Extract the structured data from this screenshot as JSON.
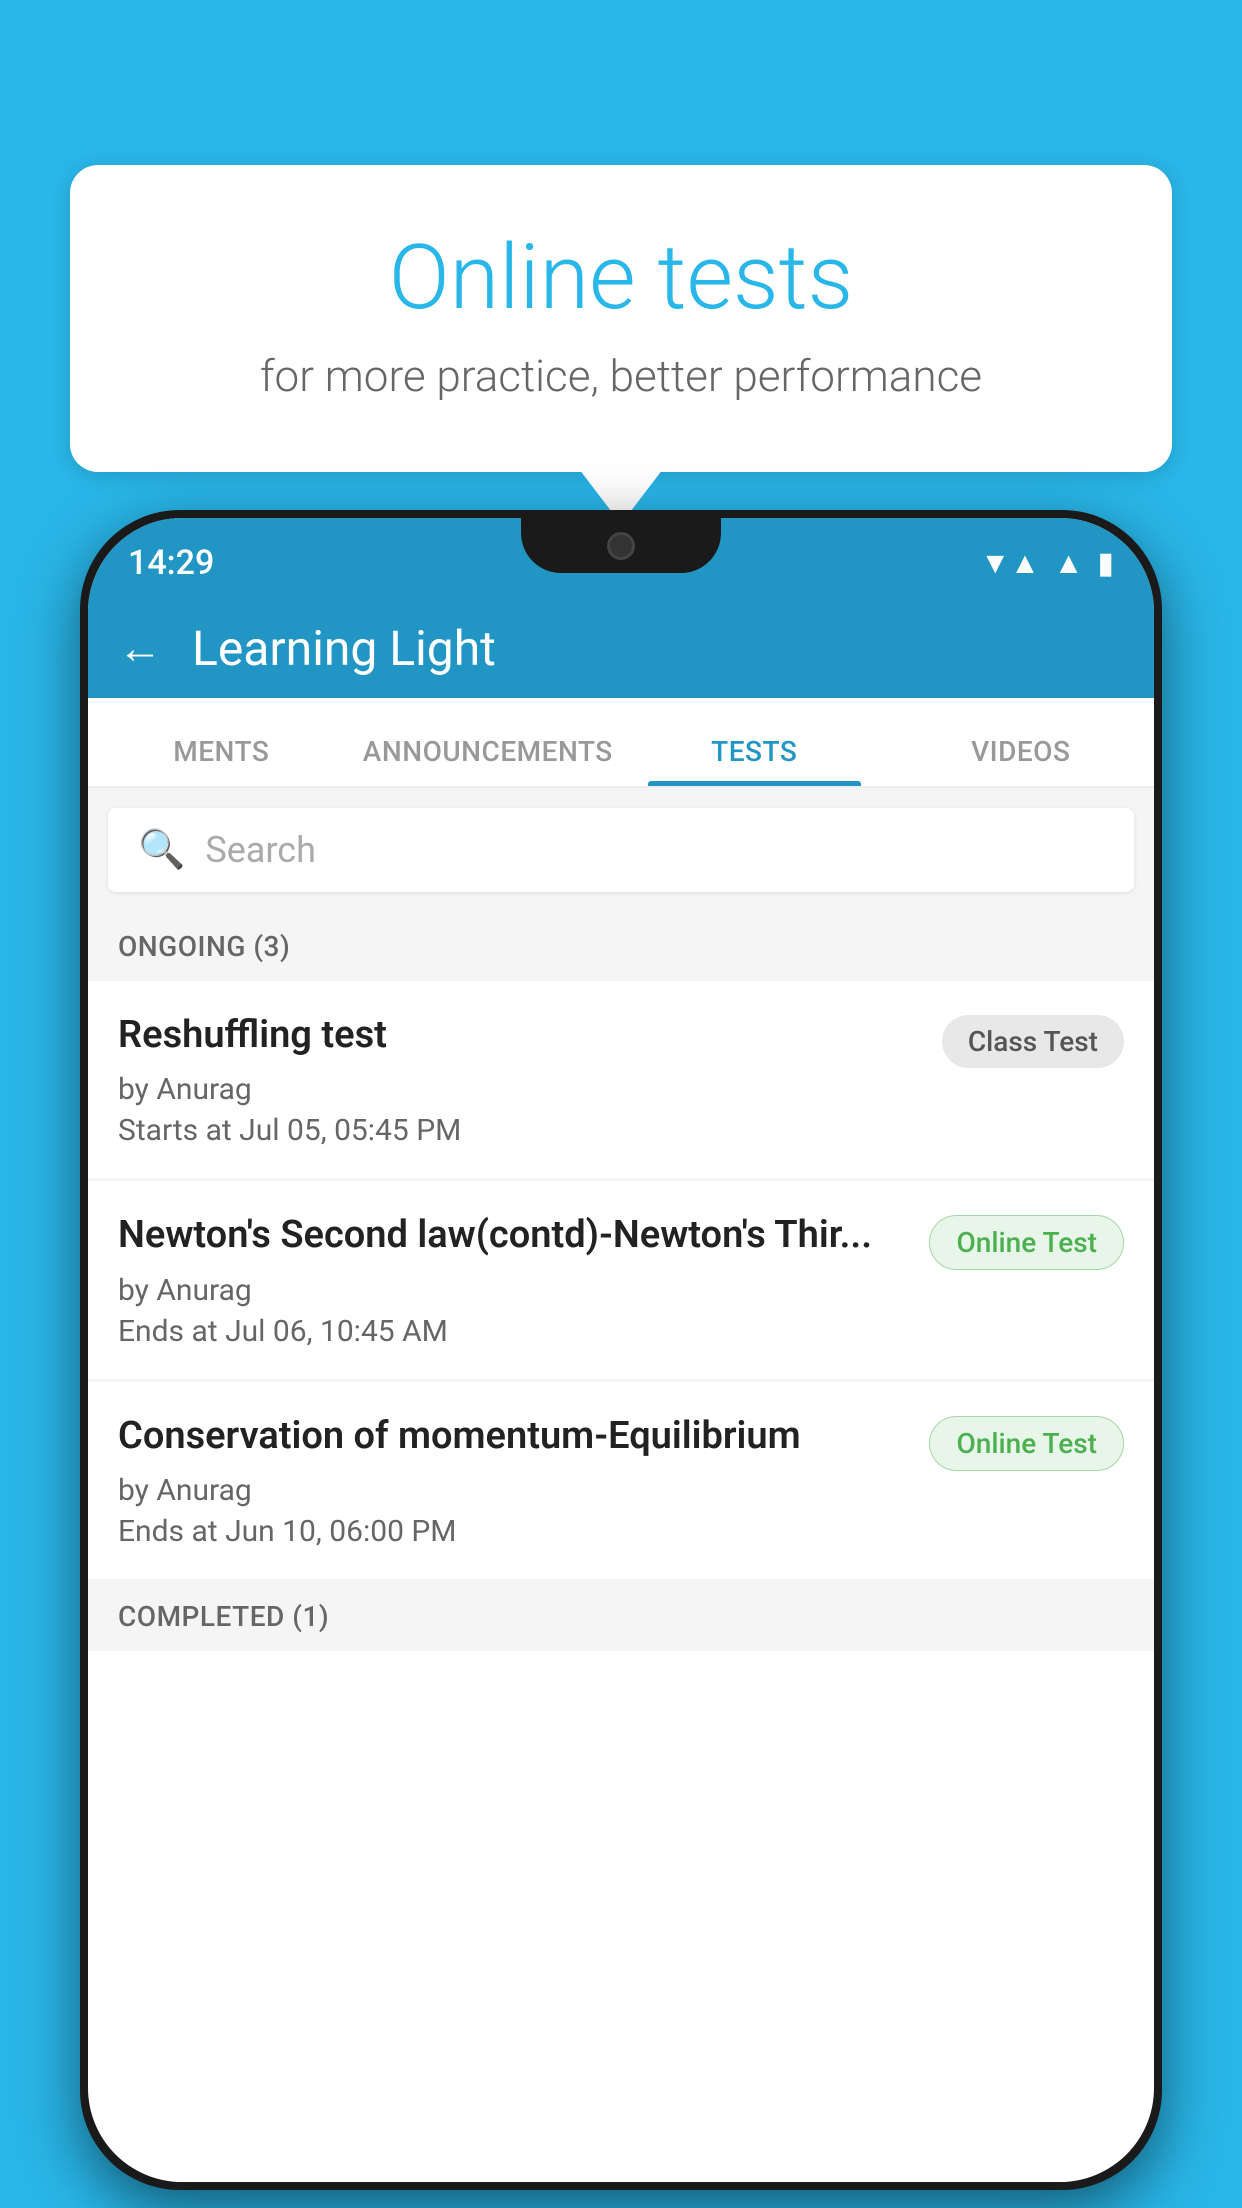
{
  "background_color": "#29b6e8",
  "bubble": {
    "title": "Online tests",
    "subtitle": "for more practice, better performance"
  },
  "status_bar": {
    "time": "14:29",
    "wifi_icon": "▼",
    "signal_icon": "▲",
    "battery_icon": "▮"
  },
  "app_bar": {
    "title": "Learning Light",
    "back_label": "←"
  },
  "tabs": [
    {
      "label": "MENTS",
      "active": false
    },
    {
      "label": "ANNOUNCEMENTS",
      "active": false
    },
    {
      "label": "TESTS",
      "active": true
    },
    {
      "label": "VIDEOS",
      "active": false
    }
  ],
  "search": {
    "placeholder": "Search"
  },
  "ongoing_section": {
    "header": "ONGOING (3)",
    "items": [
      {
        "name": "Reshuffling test",
        "by": "by Anurag",
        "time_label": "Starts at",
        "time_value": "Jul 05, 05:45 PM",
        "badge": "Class Test",
        "badge_type": "class"
      },
      {
        "name": "Newton's Second law(contd)-Newton's Thir...",
        "by": "by Anurag",
        "time_label": "Ends at",
        "time_value": "Jul 06, 10:45 AM",
        "badge": "Online Test",
        "badge_type": "online"
      },
      {
        "name": "Conservation of momentum-Equilibrium",
        "by": "by Anurag",
        "time_label": "Ends at",
        "time_value": "Jun 10, 06:00 PM",
        "badge": "Online Test",
        "badge_type": "online"
      }
    ]
  },
  "completed_section": {
    "header": "COMPLETED (1)"
  }
}
